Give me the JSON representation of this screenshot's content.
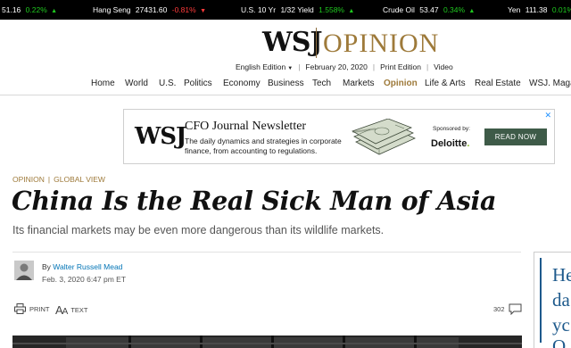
{
  "ticker": [
    {
      "name": "",
      "value": "51.16",
      "change": "0.22%",
      "dir": "up"
    },
    {
      "name": "Hang Seng",
      "value": "27431.60",
      "change": "-0.81%",
      "dir": "down"
    },
    {
      "name": "U.S. 10 Yr",
      "value": "1/32 Yield",
      "change": "1.558%",
      "dir": "up"
    },
    {
      "name": "Crude Oil",
      "value": "53.47",
      "change": "0.34%",
      "dir": "up"
    },
    {
      "name": "Yen",
      "value": "111.38",
      "change": "0.01%",
      "dir": "up"
    }
  ],
  "masthead": {
    "logo": "WSJ",
    "section": "OPINION"
  },
  "subnav": {
    "edition": "English Edition",
    "date": "February 20, 2020",
    "print": "Print Edition",
    "video": "Video"
  },
  "nav": [
    "Home",
    "World",
    "U.S.",
    "Politics",
    "Economy",
    "Business",
    "Tech",
    "Markets",
    "Opinion",
    "Life & Arts",
    "Real Estate",
    "WSJ. Maga"
  ],
  "ad": {
    "logo": "WSJ",
    "title": "CFO Journal Newsletter",
    "desc": "The daily dynamics and strategies in corporate finance, from accounting to regulations.",
    "sponsored": "Sponsored by:",
    "sponsor": "Deloitte",
    "sponsor_dot": ".",
    "cta": "READ NOW",
    "close": "✕"
  },
  "article": {
    "section": "OPINION",
    "column": "GLOBAL VIEW",
    "headline": "China Is the Real Sick Man of Asia",
    "dek": "Its financial markets may be even more dangerous than its wildlife markets.",
    "by": "By",
    "author": "Walter Russell Mead",
    "date": "Feb. 3, 2020 6:47 pm ET"
  },
  "tools": {
    "print": "PRINT",
    "text": "TEXT",
    "comments": "302"
  },
  "promo": {
    "lines": [
      "He",
      "da",
      "yc",
      "O"
    ]
  },
  "colors": {
    "up": "#1fc91f",
    "down": "#ff3b3b",
    "opinion_gold": "#9e7a3a",
    "author_link": "#0274b6",
    "cta_bg": "#3e5b48"
  }
}
